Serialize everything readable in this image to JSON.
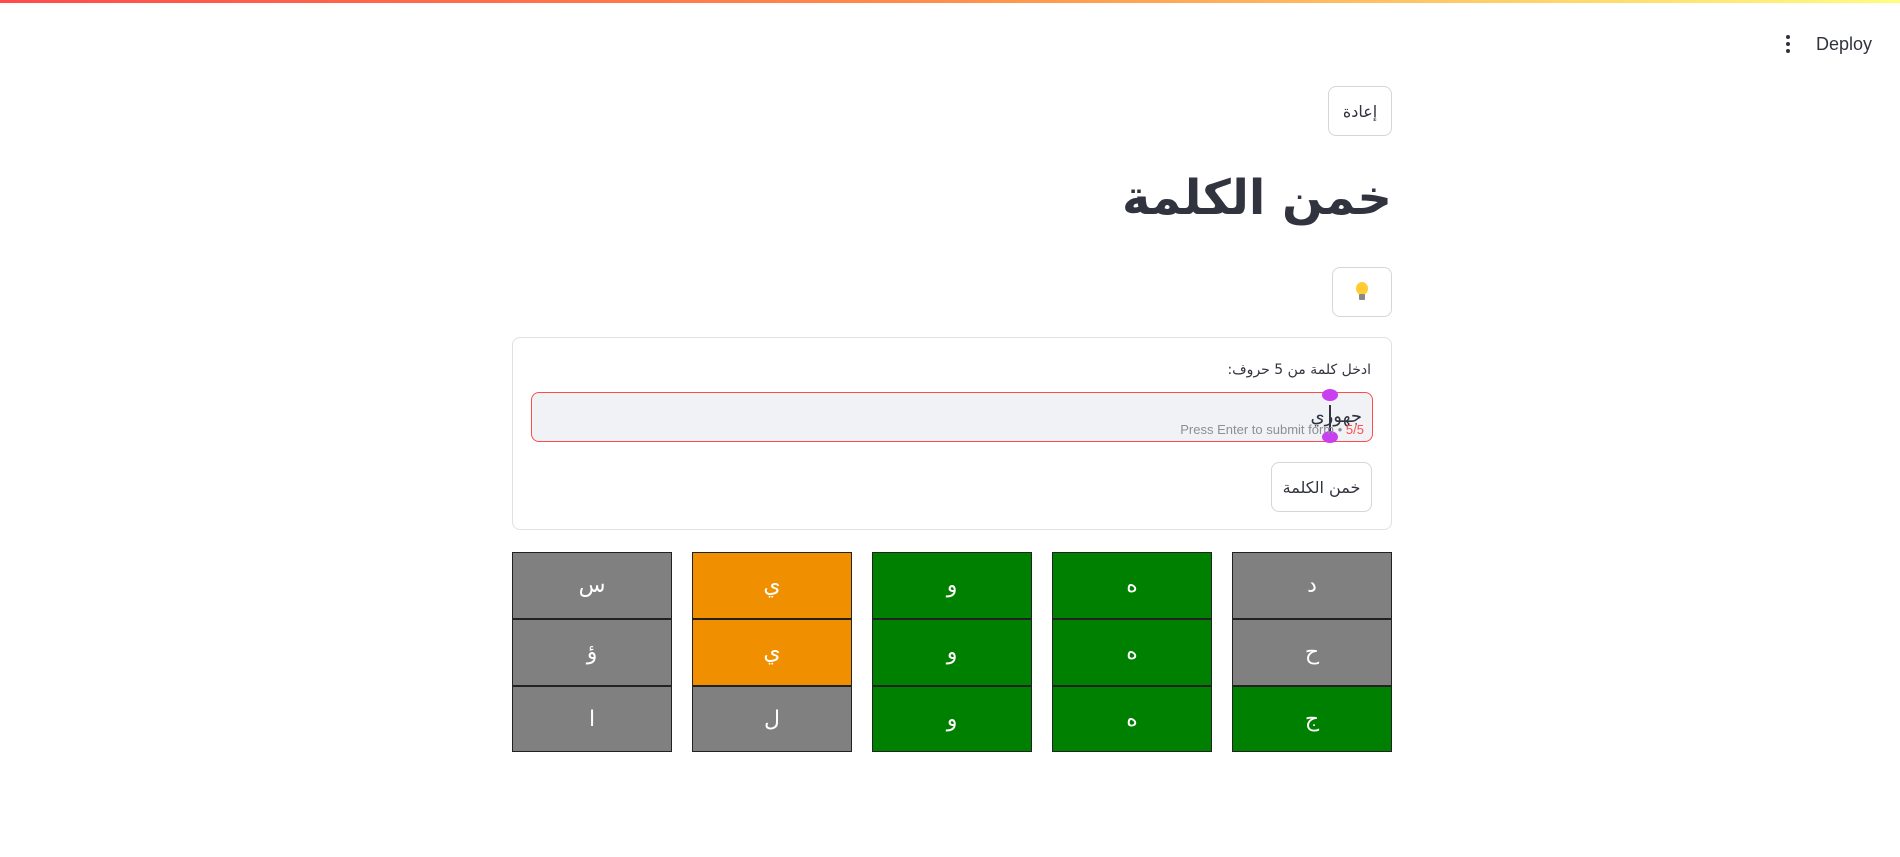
{
  "header": {
    "deploy_label": "Deploy",
    "menu_icon": "kebab-menu-icon"
  },
  "reset_button_label": "إعادة",
  "title": "خمن الكلمة",
  "hint_button": {
    "icon": "lightbulb-icon"
  },
  "form": {
    "label": "ادخل كلمة من 5 حروف:",
    "input_value": "جهوري",
    "input_hint": "Press Enter to submit form",
    "char_count": "5/5",
    "submit_label": "خمن الكلمة"
  },
  "colors": {
    "green": "#008000",
    "orange": "#f09000",
    "gray": "#808080",
    "error": "#ff4b4b"
  },
  "board": {
    "rows": [
      [
        {
          "letter": "د",
          "status": "gray"
        },
        {
          "letter": "ه",
          "status": "green"
        },
        {
          "letter": "و",
          "status": "green"
        },
        {
          "letter": "ي",
          "status": "orange"
        },
        {
          "letter": "س",
          "status": "gray"
        }
      ],
      [
        {
          "letter": "ح",
          "status": "gray"
        },
        {
          "letter": "ه",
          "status": "green"
        },
        {
          "letter": "و",
          "status": "green"
        },
        {
          "letter": "ي",
          "status": "orange"
        },
        {
          "letter": "ؤ",
          "status": "gray"
        }
      ],
      [
        {
          "letter": "ج",
          "status": "green"
        },
        {
          "letter": "ه",
          "status": "green"
        },
        {
          "letter": "و",
          "status": "green"
        },
        {
          "letter": "ل",
          "status": "gray"
        },
        {
          "letter": "ا",
          "status": "gray"
        }
      ]
    ]
  }
}
